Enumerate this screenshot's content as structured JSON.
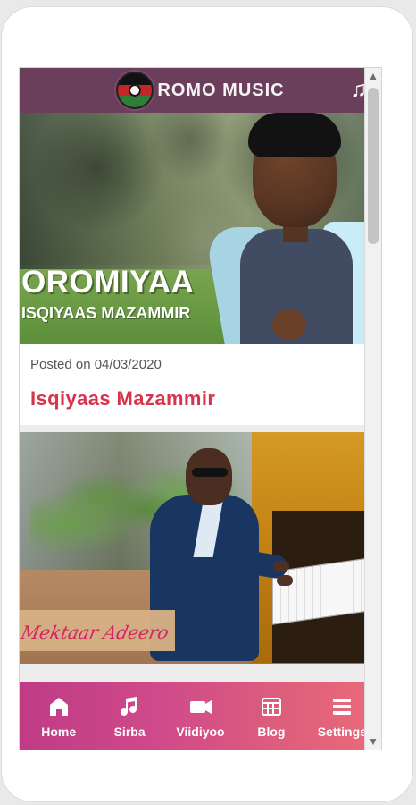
{
  "header": {
    "logo_text": "ROMO MUSIC",
    "right_icon": "music-note-icon"
  },
  "posts": [
    {
      "image_title": "OROMIYAA",
      "image_subtitle": "ISQIYAAS MAZAMMIR",
      "posted_on": "Posted on 04/03/2020",
      "title": "Isqiyaas Mazammir"
    },
    {
      "image_signature": "Mektaar Adeero"
    }
  ],
  "bottom_nav": {
    "items": [
      {
        "label": "Home",
        "icon": "home-icon"
      },
      {
        "label": "Sirba",
        "icon": "music-icon"
      },
      {
        "label": "Viidiyoo",
        "icon": "video-icon"
      },
      {
        "label": "Blog",
        "icon": "blog-icon"
      },
      {
        "label": "Settings",
        "icon": "menu-icon"
      }
    ]
  },
  "colors": {
    "topbar": "#6b3f5b",
    "accent_title": "#d7344d",
    "bottom_nav_start": "#bf3b86",
    "bottom_nav_end": "#ea6b79"
  }
}
